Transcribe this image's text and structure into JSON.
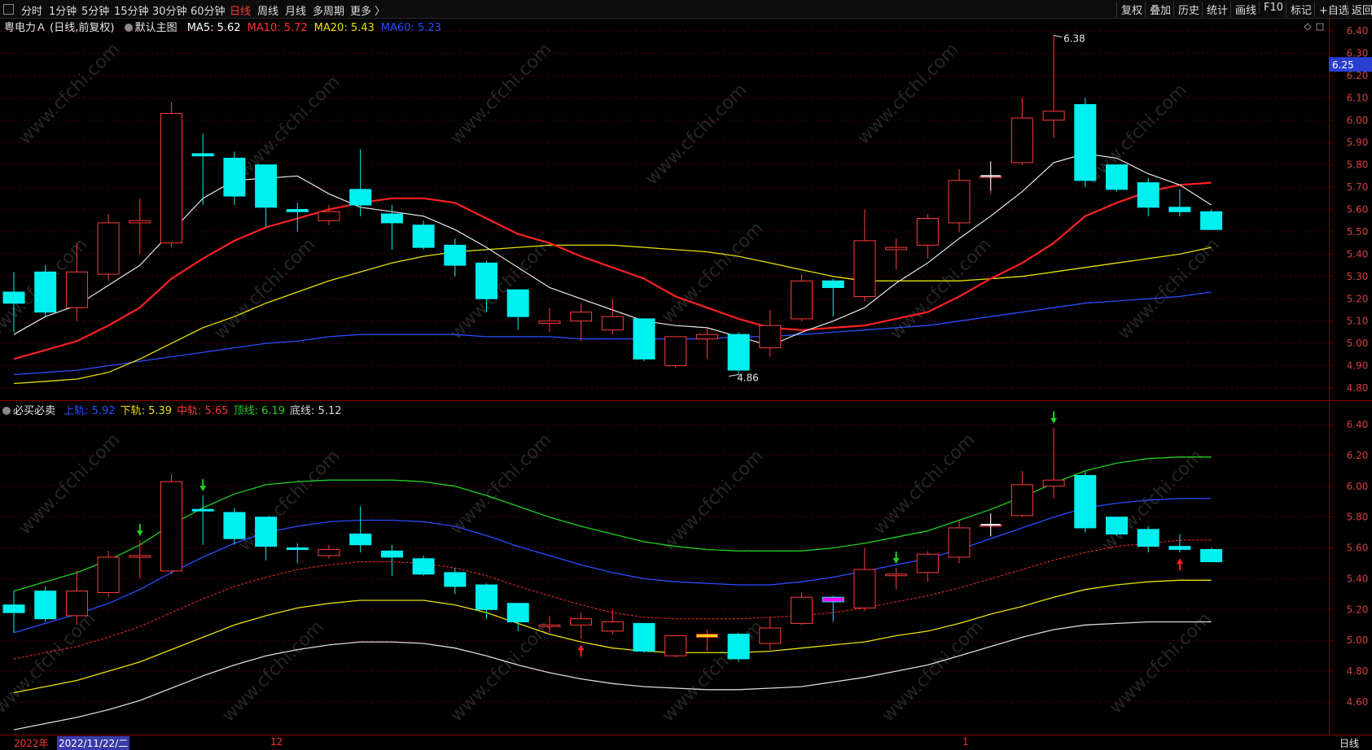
{
  "toolbar": {
    "periods": [
      "分时",
      "1分钟",
      "5分钟",
      "15分钟",
      "30分钟",
      "60分钟",
      "日线",
      "周线",
      "月线",
      "多周期",
      "更多 〉"
    ],
    "active_period": "日线",
    "right_buttons": [
      "复权",
      "叠加",
      "历史",
      "统计",
      "画线",
      "F10",
      "标记",
      "+自选",
      "返回"
    ]
  },
  "main_chart": {
    "stock_title": "粤电力Ａ (日线,前复权)",
    "template_label": "默认主图",
    "ma_items": [
      {
        "label": "MA5: 5.62",
        "color": "#ffffff"
      },
      {
        "label": "MA10: 5.72",
        "color": "#ff3030"
      },
      {
        "label": "MA20: 5.43",
        "color": "#e8e000"
      },
      {
        "label": "MA60: 5.23",
        "color": "#2a4cff"
      }
    ],
    "price_ticks": [
      "6.40",
      "6.30",
      "6.20",
      "6.10",
      "6.00",
      "5.90",
      "5.80",
      "5.70",
      "5.60",
      "5.50",
      "5.40",
      "5.30",
      "5.20",
      "5.10",
      "5.00",
      "4.90",
      "4.80"
    ],
    "current_price": "6.25",
    "high_label": "6.38",
    "low_label": "4.86"
  },
  "indicator": {
    "name": "必买必卖",
    "items": [
      {
        "label": "上轨: 5.92",
        "color": "#2a4cff"
      },
      {
        "label": "下轨: 5.39",
        "color": "#e8e000"
      },
      {
        "label": "中轨: 5.65",
        "color": "#ff3030"
      },
      {
        "label": "顶线: 6.19",
        "color": "#20d020"
      },
      {
        "label": "底线: 5.12",
        "color": "#d8d8d8"
      }
    ],
    "ticks": [
      "6.40",
      "6.20",
      "6.00",
      "5.80",
      "5.60",
      "5.40",
      "5.20",
      "5.00",
      "4.80",
      "4.60"
    ]
  },
  "footer": {
    "year_label": "2022年",
    "cursor_date": "2022/11/22/二",
    "month_12": "12",
    "month_1": "1",
    "period_label": "日线"
  },
  "watermark": "www.cfchi.com",
  "chart_data": {
    "type": "candlestick",
    "candles": [
      {
        "o": 5.23,
        "h": 5.32,
        "l": 5.05,
        "c": 5.18
      },
      {
        "o": 5.32,
        "h": 5.35,
        "l": 5.12,
        "c": 5.14
      },
      {
        "o": 5.16,
        "h": 5.45,
        "l": 5.1,
        "c": 5.32
      },
      {
        "o": 5.31,
        "h": 5.58,
        "l": 5.28,
        "c": 5.54
      },
      {
        "o": 5.54,
        "h": 5.65,
        "l": 5.4,
        "c": 5.55
      },
      {
        "o": 5.45,
        "h": 6.08,
        "l": 5.43,
        "c": 6.03
      },
      {
        "o": 5.85,
        "h": 5.94,
        "l": 5.62,
        "c": 5.84
      },
      {
        "o": 5.83,
        "h": 5.86,
        "l": 5.62,
        "c": 5.66
      },
      {
        "o": 5.8,
        "h": 5.8,
        "l": 5.52,
        "c": 5.61
      },
      {
        "o": 5.6,
        "h": 5.63,
        "l": 5.5,
        "c": 5.59
      },
      {
        "o": 5.55,
        "h": 5.62,
        "l": 5.53,
        "c": 5.59
      },
      {
        "o": 5.69,
        "h": 5.87,
        "l": 5.57,
        "c": 5.62
      },
      {
        "o": 5.58,
        "h": 5.62,
        "l": 5.42,
        "c": 5.54
      },
      {
        "o": 5.53,
        "h": 5.55,
        "l": 5.42,
        "c": 5.43
      },
      {
        "o": 5.44,
        "h": 5.47,
        "l": 5.3,
        "c": 5.35
      },
      {
        "o": 5.36,
        "h": 5.37,
        "l": 5.14,
        "c": 5.2
      },
      {
        "o": 5.24,
        "h": 5.24,
        "l": 5.06,
        "c": 5.12
      },
      {
        "o": 5.09,
        "h": 5.16,
        "l": 5.05,
        "c": 5.1
      },
      {
        "o": 5.1,
        "h": 5.18,
        "l": 5.01,
        "c": 5.14
      },
      {
        "o": 5.06,
        "h": 5.2,
        "l": 5.04,
        "c": 5.12
      },
      {
        "o": 5.11,
        "h": 5.11,
        "l": 4.92,
        "c": 4.93
      },
      {
        "o": 4.9,
        "h": 5.03,
        "l": 4.89,
        "c": 5.03
      },
      {
        "o": 5.02,
        "h": 5.07,
        "l": 4.93,
        "c": 5.04
      },
      {
        "o": 5.04,
        "h": 5.05,
        "l": 4.86,
        "c": 4.88
      },
      {
        "o": 4.98,
        "h": 5.15,
        "l": 4.94,
        "c": 5.08
      },
      {
        "o": 5.11,
        "h": 5.31,
        "l": 5.1,
        "c": 5.28
      },
      {
        "o": 5.28,
        "h": 5.29,
        "l": 5.12,
        "c": 5.25
      },
      {
        "o": 5.21,
        "h": 5.6,
        "l": 5.19,
        "c": 5.46
      },
      {
        "o": 5.42,
        "h": 5.47,
        "l": 5.33,
        "c": 5.43
      },
      {
        "o": 5.44,
        "h": 5.58,
        "l": 5.38,
        "c": 5.56
      },
      {
        "o": 5.54,
        "h": 5.78,
        "l": 5.5,
        "c": 5.73
      },
      {
        "o": 5.75,
        "h": 5.79,
        "l": 5.67,
        "c": 5.75
      },
      {
        "o": 5.81,
        "h": 6.1,
        "l": 5.8,
        "c": 6.01
      },
      {
        "o": 6.0,
        "h": 6.38,
        "l": 5.92,
        "c": 6.04
      },
      {
        "o": 6.07,
        "h": 6.1,
        "l": 5.7,
        "c": 5.73
      },
      {
        "o": 5.8,
        "h": 5.8,
        "l": 5.68,
        "c": 5.69
      },
      {
        "o": 5.72,
        "h": 5.74,
        "l": 5.57,
        "c": 5.61
      },
      {
        "o": 5.61,
        "h": 5.69,
        "l": 5.57,
        "c": 5.59
      },
      {
        "o": 5.59,
        "h": 5.6,
        "l": 5.51,
        "c": 5.51
      }
    ],
    "ma5": [
      5.04,
      5.12,
      5.17,
      5.26,
      5.35,
      5.5,
      5.65,
      5.73,
      5.74,
      5.75,
      5.67,
      5.61,
      5.59,
      5.57,
      5.51,
      5.43,
      5.34,
      5.25,
      5.2,
      5.15,
      5.1,
      5.08,
      5.07,
      5.03,
      4.99,
      5.05,
      5.1,
      5.16,
      5.27,
      5.36,
      5.47,
      5.57,
      5.68,
      5.81,
      5.85,
      5.83,
      5.76,
      5.71,
      5.62
    ],
    "ma10": [
      4.93,
      4.97,
      5.01,
      5.08,
      5.16,
      5.29,
      5.38,
      5.46,
      5.52,
      5.56,
      5.6,
      5.63,
      5.65,
      5.65,
      5.63,
      5.56,
      5.49,
      5.45,
      5.39,
      5.34,
      5.29,
      5.21,
      5.16,
      5.11,
      5.07,
      5.06,
      5.07,
      5.08,
      5.11,
      5.14,
      5.21,
      5.29,
      5.36,
      5.45,
      5.57,
      5.63,
      5.68,
      5.71,
      5.72
    ],
    "ma20": [
      4.82,
      4.83,
      4.84,
      4.87,
      4.93,
      5.0,
      5.07,
      5.12,
      5.18,
      5.23,
      5.28,
      5.32,
      5.36,
      5.39,
      5.41,
      5.42,
      5.43,
      5.44,
      5.44,
      5.44,
      5.43,
      5.42,
      5.41,
      5.39,
      5.36,
      5.33,
      5.3,
      5.28,
      5.28,
      5.28,
      5.28,
      5.29,
      5.3,
      5.32,
      5.34,
      5.36,
      5.38,
      5.4,
      5.43
    ],
    "ma60": [
      4.86,
      4.87,
      4.88,
      4.9,
      4.92,
      4.94,
      4.96,
      4.98,
      5.0,
      5.01,
      5.03,
      5.04,
      5.04,
      5.04,
      5.04,
      5.03,
      5.03,
      5.03,
      5.02,
      5.02,
      5.02,
      5.02,
      5.02,
      5.03,
      5.03,
      5.04,
      5.05,
      5.06,
      5.07,
      5.08,
      5.1,
      5.12,
      5.14,
      5.16,
      5.18,
      5.19,
      5.2,
      5.21,
      5.23
    ],
    "ind_top": [
      5.32,
      5.38,
      5.44,
      5.52,
      5.62,
      5.75,
      5.86,
      5.95,
      6.01,
      6.03,
      6.04,
      6.04,
      6.04,
      6.03,
      6.0,
      5.94,
      5.87,
      5.8,
      5.74,
      5.69,
      5.64,
      5.61,
      5.59,
      5.58,
      5.58,
      5.58,
      5.6,
      5.63,
      5.67,
      5.71,
      5.78,
      5.85,
      5.93,
      6.02,
      6.1,
      6.15,
      6.18,
      6.19,
      6.19
    ],
    "ind_upper": [
      5.05,
      5.11,
      5.17,
      5.24,
      5.33,
      5.44,
      5.54,
      5.63,
      5.7,
      5.74,
      5.77,
      5.78,
      5.78,
      5.77,
      5.74,
      5.68,
      5.61,
      5.55,
      5.49,
      5.44,
      5.4,
      5.38,
      5.37,
      5.36,
      5.36,
      5.38,
      5.41,
      5.45,
      5.49,
      5.53,
      5.59,
      5.66,
      5.73,
      5.8,
      5.86,
      5.89,
      5.91,
      5.92,
      5.92
    ],
    "ind_mid": [
      4.88,
      4.92,
      4.96,
      5.02,
      5.09,
      5.18,
      5.27,
      5.35,
      5.41,
      5.46,
      5.49,
      5.51,
      5.51,
      5.5,
      5.47,
      5.42,
      5.35,
      5.29,
      5.23,
      5.18,
      5.15,
      5.14,
      5.14,
      5.14,
      5.15,
      5.16,
      5.18,
      5.21,
      5.25,
      5.29,
      5.34,
      5.4,
      5.46,
      5.52,
      5.57,
      5.61,
      5.63,
      5.65,
      5.65
    ],
    "ind_lower": [
      4.66,
      4.7,
      4.74,
      4.8,
      4.86,
      4.94,
      5.02,
      5.1,
      5.16,
      5.21,
      5.24,
      5.26,
      5.26,
      5.26,
      5.23,
      5.18,
      5.11,
      5.04,
      4.99,
      4.95,
      4.93,
      4.92,
      4.92,
      4.92,
      4.93,
      4.95,
      4.97,
      4.99,
      5.03,
      5.06,
      5.11,
      5.17,
      5.22,
      5.28,
      5.33,
      5.36,
      5.38,
      5.39,
      5.39
    ],
    "ind_bottom": [
      4.42,
      4.46,
      4.5,
      4.55,
      4.61,
      4.69,
      4.77,
      4.84,
      4.9,
      4.94,
      4.97,
      4.99,
      4.99,
      4.98,
      4.95,
      4.9,
      4.84,
      4.79,
      4.75,
      4.72,
      4.7,
      4.69,
      4.68,
      4.68,
      4.69,
      4.7,
      4.73,
      4.76,
      4.8,
      4.84,
      4.9,
      4.96,
      5.02,
      5.07,
      5.1,
      5.11,
      5.12,
      5.12,
      5.12
    ],
    "highlight_colors": {
      "22": "#e8e000",
      "26": "#ff00ff"
    },
    "down_arrows": [
      4,
      6,
      28,
      33
    ],
    "up_arrows": [
      18,
      37
    ]
  }
}
